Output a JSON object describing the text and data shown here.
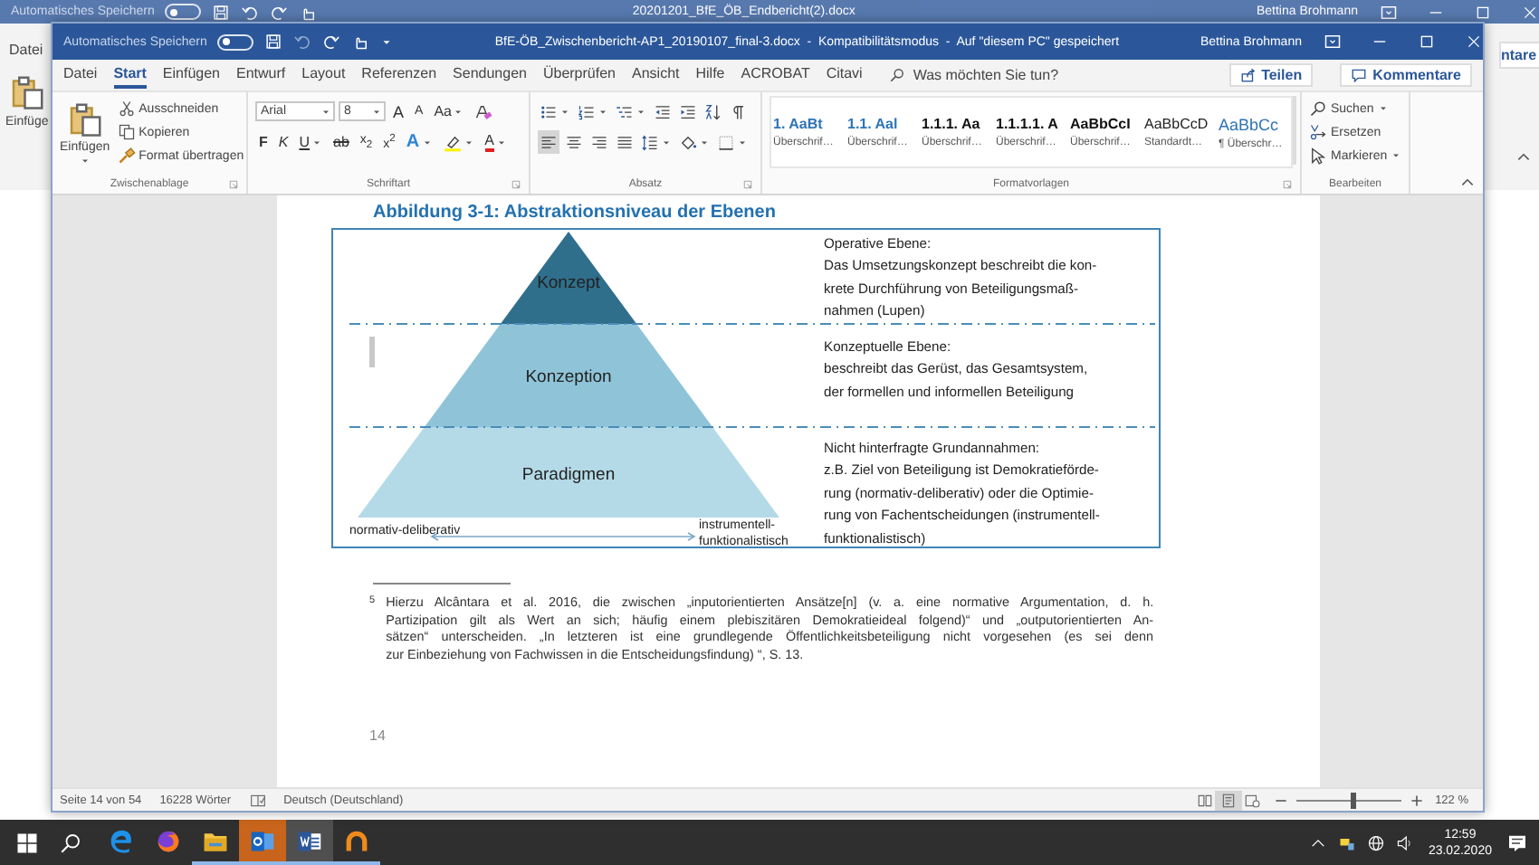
{
  "background_window": {
    "autosave_label": "Automatisches Speichern",
    "autosave_on": false,
    "title": "20201201_BfE_ÖB_Endbericht(2).docx",
    "user": "Bettina Brohmann",
    "tab": "Datei",
    "paste_label": "Einfüge",
    "comments_button": "ntare"
  },
  "window": {
    "autosave_label": "Automatisches Speichern",
    "autosave_on": false,
    "title": "BfE-ÖB_Zwischenbericht-AP1_20190107_final-3.docx  -  Kompatibilitätsmodus  -  Auf \"diesem PC\" gespeichert",
    "user": "Bettina Brohmann"
  },
  "tabs": [
    {
      "label": "Datei",
      "selected": false
    },
    {
      "label": "Start",
      "selected": true
    },
    {
      "label": "Einfügen",
      "selected": false
    },
    {
      "label": "Entwurf",
      "selected": false
    },
    {
      "label": "Layout",
      "selected": false
    },
    {
      "label": "Referenzen",
      "selected": false
    },
    {
      "label": "Sendungen",
      "selected": false
    },
    {
      "label": "Überprüfen",
      "selected": false
    },
    {
      "label": "Ansicht",
      "selected": false
    },
    {
      "label": "Hilfe",
      "selected": false
    },
    {
      "label": "ACROBAT",
      "selected": false
    },
    {
      "label": "Citavi",
      "selected": false
    }
  ],
  "tell_me": {
    "placeholder": "Was möchten Sie tun?"
  },
  "share_button": "Teilen",
  "comments_button": "Kommentare",
  "clipboard": {
    "group": "Zwischenablage",
    "paste": "Einfügen",
    "items": [
      {
        "kind": "cut",
        "label": "Ausschneiden"
      },
      {
        "kind": "copy",
        "label": "Kopieren"
      },
      {
        "kind": "brush",
        "label": "Format übertragen"
      }
    ]
  },
  "font": {
    "group": "Schriftart",
    "family": "Arial",
    "size": "8",
    "row1": [
      {
        "kind": "grow",
        "text": "A"
      },
      {
        "kind": "shrink",
        "text": "A"
      },
      {
        "kind": "case",
        "text": "Aa"
      },
      {
        "kind": "clear"
      }
    ],
    "row2": [
      {
        "kind": "bold",
        "text": "F"
      },
      {
        "kind": "italic",
        "text": "K"
      },
      {
        "kind": "underline",
        "text": "U"
      },
      {
        "kind": "strike",
        "text": "ab"
      },
      {
        "kind": "sub",
        "text": "x$_{2}$"
      },
      {
        "kind": "sup",
        "text": "x$^{2}$"
      },
      {
        "kind": "effects",
        "text": "A"
      },
      {
        "kind": "highlight"
      },
      {
        "kind": "color",
        "text": "A"
      }
    ]
  },
  "paragraph": {
    "group": "Absatz",
    "row1": [
      {
        "kind": "bullets"
      },
      {
        "kind": "numbering"
      },
      {
        "kind": "multilevel"
      },
      {
        "kind": "outdent"
      },
      {
        "kind": "indent"
      },
      {
        "kind": "sort"
      },
      {
        "kind": "pilcrow"
      }
    ],
    "row2": [
      {
        "kind": "align-left",
        "selected": true
      },
      {
        "kind": "center",
        "selected": false
      },
      {
        "kind": "align-right",
        "selected": false
      },
      {
        "kind": "justify",
        "selected": false
      },
      {
        "kind": "line-spacing",
        "selected": false
      },
      {
        "kind": "shading",
        "selected": false
      },
      {
        "kind": "borders",
        "selected": false
      }
    ]
  },
  "styles": {
    "group": "Formatvorlagen",
    "items": [
      {
        "kind": "blue",
        "preview": "1. AaBt",
        "name": "Überschrif…"
      },
      {
        "kind": "blue",
        "preview": "1.1. Aal",
        "name": "Überschrif…"
      },
      {
        "kind": "black",
        "preview": "1.1.1. Aa",
        "name": "Überschrif…"
      },
      {
        "kind": "black",
        "preview": "1.1.1.1. A",
        "name": "Überschrif…"
      },
      {
        "kind": "black",
        "preview": "AaBbCcI",
        "name": "Überschrif…"
      },
      {
        "kind": "plain",
        "preview": "AaBbCcD",
        "name": "Standardt…"
      },
      {
        "kind": "blue-large",
        "preview": "AaBbCc",
        "name": "¶ Überschr…"
      }
    ]
  },
  "editing": {
    "group": "Bearbeiten",
    "items": [
      {
        "kind": "find",
        "label": "Suchen"
      },
      {
        "kind": "replace",
        "label": "Ersetzen"
      },
      {
        "kind": "select",
        "label": "Markieren"
      }
    ]
  },
  "document": {
    "figure": {
      "title": "Abbildung 3-1: Abstraktionsniveau der Ebenen",
      "levels": [
        {
          "label": "Konzept",
          "color": "#2f6f8c"
        },
        {
          "label": "Konzeption",
          "color": "#8fc4d8"
        },
        {
          "label": "Paradigmen",
          "color": "#b4dae8"
        }
      ],
      "axis_left": "normativ-deliberativ",
      "axis_right": "instrumentell-\nfunktionalistisch",
      "descriptions": [
        {
          "heading": "Operative Ebene:",
          "text": "Das Umsetzungskonzept beschreibt die kon-\nkrete Durchführung von Beteiligungsmaß-\nnahmen (Lupen)"
        },
        {
          "heading": "Konzeptuelle Ebene:",
          "text": "beschreibt das Gerüst, das Gesamtsystem,\nder formellen und informellen Beteiligung"
        },
        {
          "heading": "Nicht hinterfragte Grundannahmen:",
          "text": "z.B. Ziel von Beteiligung ist Demokratieförde-\nrung (normativ-deliberativ) oder die Optimie-\nrung von Fachentscheidungen (instrumentell-\nfunktionalistisch)"
        }
      ]
    },
    "footnote": {
      "number": "5",
      "lines": [
        "Hierzu Alcântara et al. 2016, die zwischen „inputorientierten Ansätze[n] (v. a. eine normative Argumentation, d. h.",
        "Partizipation gilt als Wert an sich; häufig einem plebiszitären Demokratieideal folgend)“ und „outputorientierten An-",
        "sätzen“ unterscheiden. „In letzteren ist eine grundlegende Öffentlichkeitsbeteiligung nicht vorgesehen (es sei denn",
        "zur Einbeziehung von Fachwissen in die Entscheidungsfindung) “, S. 13."
      ]
    },
    "page_number": "14"
  },
  "status_bar": {
    "page": "Seite 14 von 54",
    "words": "16228 Wörter",
    "language": "Deutsch (Deutschland)",
    "views": [
      {
        "kind": "read",
        "selected": false
      },
      {
        "kind": "print",
        "selected": true
      },
      {
        "kind": "web",
        "selected": false
      }
    ],
    "zoom": {
      "level": 0.55,
      "reading": "122 %"
    }
  },
  "taskbar": {
    "apps": [
      {
        "kind": "edge",
        "running": false,
        "active": false,
        "flashing": false
      },
      {
        "kind": "firefox",
        "running": false,
        "active": false,
        "flashing": false
      },
      {
        "kind": "explorer",
        "running": true,
        "active": false,
        "flashing": false
      },
      {
        "kind": "outlook",
        "running": true,
        "active": false,
        "flashing": true
      },
      {
        "kind": "word",
        "running": true,
        "active": true,
        "flashing": false
      },
      {
        "kind": "ring",
        "running": true,
        "active": false,
        "flashing": false
      }
    ],
    "time": "12:59",
    "date": "23.02.2020"
  }
}
